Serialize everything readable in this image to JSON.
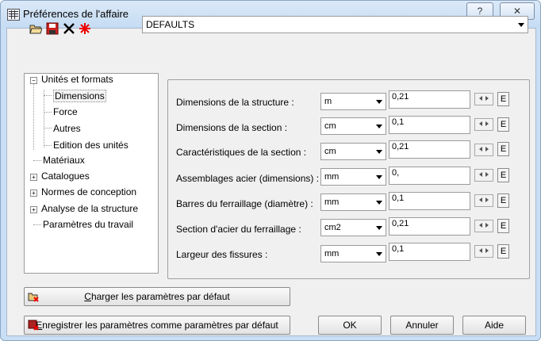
{
  "window": {
    "title": "Préférences de l'affaire",
    "help_button": "?",
    "close_button": "✕"
  },
  "toolbar": {
    "icons": [
      "open-folder-icon",
      "save-icon",
      "delete-icon",
      "new-star-icon"
    ]
  },
  "preset": {
    "value": "DEFAULTS"
  },
  "tree": {
    "items": [
      {
        "label": "Unités et formats",
        "expander": "−"
      },
      {
        "label": "Dimensions"
      },
      {
        "label": "Force"
      },
      {
        "label": "Autres"
      },
      {
        "label": "Edition des unités"
      },
      {
        "label": "Matériaux"
      },
      {
        "label": "Catalogues",
        "expander": "+"
      },
      {
        "label": "Normes de conception",
        "expander": "+"
      },
      {
        "label": "Analyse de la structure",
        "expander": "+"
      },
      {
        "label": "Paramètres du travail"
      }
    ]
  },
  "rows": [
    {
      "label": "Dimensions de la structure :",
      "unit": "m",
      "value": "0,21"
    },
    {
      "label": "Dimensions de la section :",
      "unit": "cm",
      "value": "0,1"
    },
    {
      "label": "Caractéristiques de la section :",
      "unit": "cm",
      "value": "0,21"
    },
    {
      "label": "Assemblages acier (dimensions) :",
      "unit": "mm",
      "value": "0,"
    },
    {
      "label": "Barres du ferraillage (diamètre) :",
      "unit": "mm",
      "value": "0,1"
    },
    {
      "label": "Section d'acier du ferraillage :",
      "unit": "cm2",
      "value": "0,21"
    },
    {
      "label": "Largeur des fissures :",
      "unit": "mm",
      "value": "0,1"
    }
  ],
  "e_label": "E",
  "buttons": {
    "load_defaults_mnemonic": "C",
    "load_defaults_rest": "harger les paramètres par défaut",
    "save_defaults_mnemonic": "E",
    "save_defaults_rest": "nregistrer les paramètres comme paramètres par défaut",
    "ok": "OK",
    "cancel": "Annuler",
    "help": "Aide"
  }
}
